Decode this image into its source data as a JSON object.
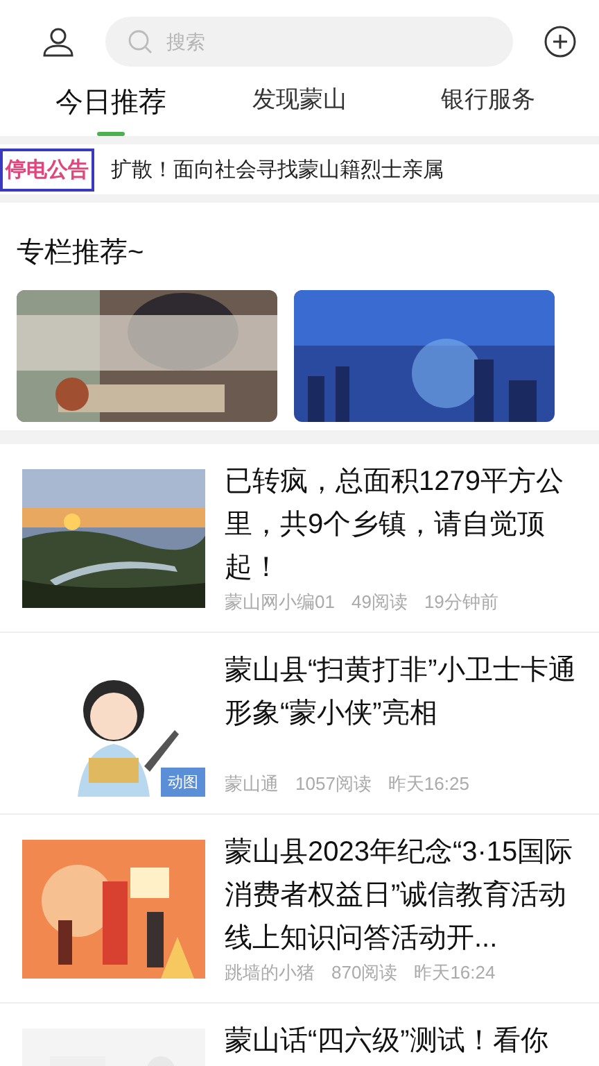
{
  "header": {
    "search": {
      "placeholder": "搜索"
    }
  },
  "tabs": [
    {
      "label": "今日推荐",
      "selected": true
    },
    {
      "label": "发现蒙山",
      "selected": false
    },
    {
      "label": "银行服务",
      "selected": false
    }
  ],
  "notice": {
    "tag": "停电公告",
    "text": "扩散！面向社会寻找蒙山籍烈士亲属"
  },
  "section": {
    "title": "专栏推荐~"
  },
  "articles": [
    {
      "title": "已转疯，总面积1279平方公里，共9个乡镇，请自觉顶起！",
      "author": "蒙山网小编01",
      "reads": "49阅读",
      "time": "19分钟前"
    },
    {
      "title": "蒙山县“扫黄打非”小卫士卡通形象“蒙小侠”亮相",
      "author": "蒙山通",
      "reads": "1057阅读",
      "time": "昨天16:25",
      "badge": "动图"
    },
    {
      "title": "蒙山县2023年纪念“3·15国际消费者权益日”诚信教育活动线上知识问答活动开...",
      "author": "跳墙的小猪",
      "reads": "870阅读",
      "time": "昨天16:24"
    },
    {
      "title": "蒙山话“四六级”测试！看你"
    }
  ]
}
